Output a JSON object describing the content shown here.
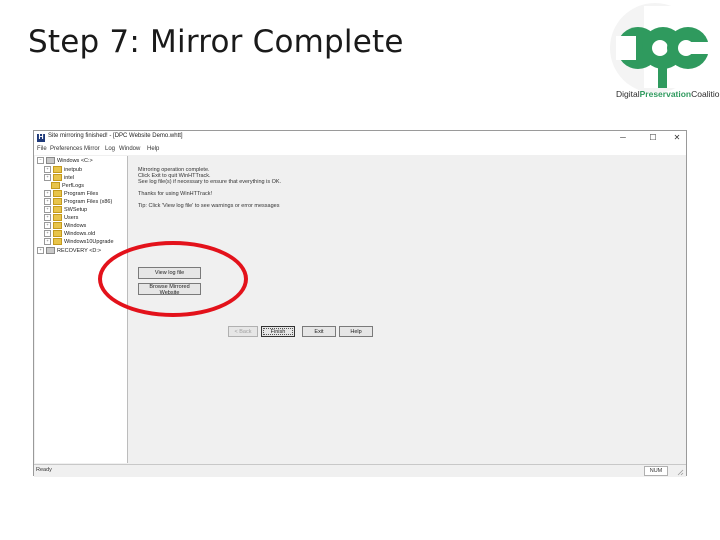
{
  "slide": {
    "title": "Step 7: Mirror Complete",
    "logo": {
      "text_grey": "Digital",
      "text_green": "Preservation",
      "text_grey2": "Coalition"
    }
  },
  "window": {
    "title": "Site mirroring finished! - [DPC Website Demo.whtt]",
    "menu": [
      "File",
      "Preferences",
      "Mirror",
      "Log",
      "Window",
      "Help"
    ],
    "controls": {
      "minimize": "─",
      "maximize": "☐",
      "close": "✕"
    }
  },
  "tree": [
    {
      "label": "Windows <C:>",
      "kind": "drive",
      "sign": "−"
    },
    {
      "label": "inetpub",
      "kind": "folder",
      "sign": "+"
    },
    {
      "label": "intel",
      "kind": "folder",
      "sign": "+"
    },
    {
      "label": "PerfLogs",
      "kind": "folder",
      "sign": ""
    },
    {
      "label": "Program Files",
      "kind": "folder",
      "sign": "+"
    },
    {
      "label": "Program Files (x86)",
      "kind": "folder",
      "sign": "+"
    },
    {
      "label": "SWSetup",
      "kind": "folder",
      "sign": "+"
    },
    {
      "label": "Users",
      "kind": "folder",
      "sign": "+"
    },
    {
      "label": "Windows",
      "kind": "folder",
      "sign": "+"
    },
    {
      "label": "Windows.old",
      "kind": "folder",
      "sign": "+"
    },
    {
      "label": "Windows10Upgrade",
      "kind": "folder",
      "sign": "+"
    },
    {
      "label": "RECOVERY <D:>",
      "kind": "drive",
      "sign": "+"
    }
  ],
  "messages": {
    "line1": "Mirroring operation complete.",
    "line2": "Click Exit to quit WinHTTrack.",
    "line3": "See log file(s) if necessary to ensure that everything is OK.",
    "line4": "Thanks for using WinHTTrack!",
    "line5": "Tip: Click 'View log file' to see warnings or error messages"
  },
  "buttons": {
    "view_log": "View log file",
    "browse": "Browse Mirrored Website",
    "back": "< Back",
    "finish": "Finish",
    "exit": "Exit",
    "help": "Help"
  },
  "status": {
    "text": "Ready",
    "num": "NUM"
  }
}
